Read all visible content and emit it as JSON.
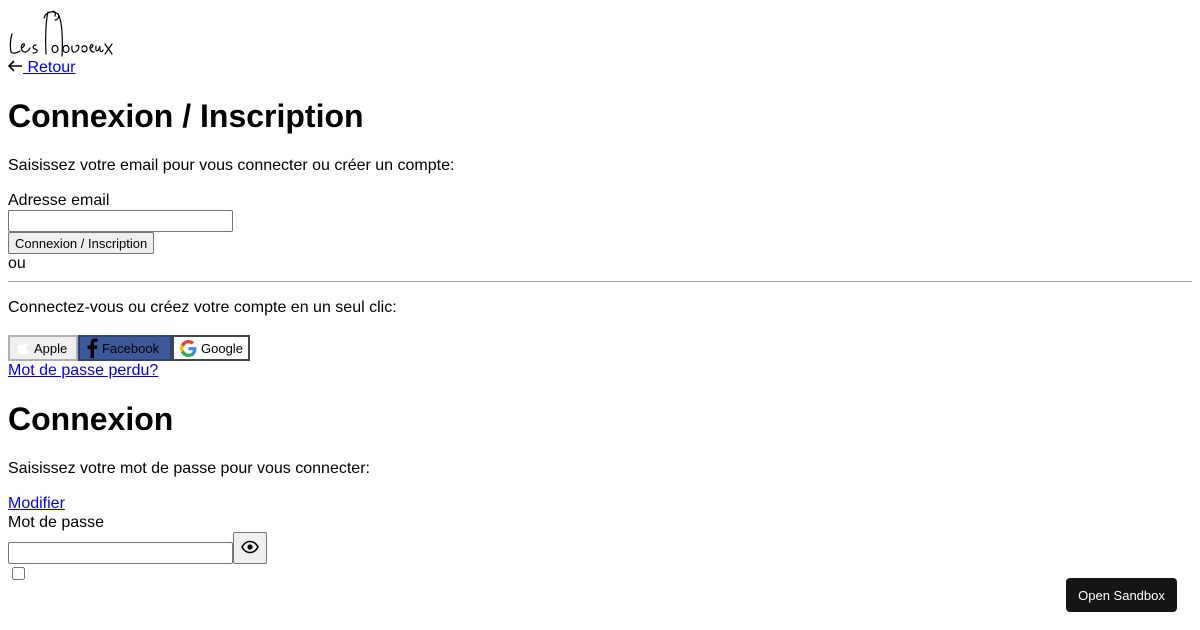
{
  "brand": {
    "logo_text": "Les Toboreux"
  },
  "nav": {
    "back_label": " Retour"
  },
  "login_signup": {
    "title": "Connexion / Inscription",
    "instruction": "Saisissez votre email pour vous connecter ou créer un compte:",
    "email_label": "Adresse email",
    "email_value": "",
    "submit_label": "Connexion / Inscription",
    "or_text": "ou",
    "social_instruction": "Connectez-vous ou créez votre compte en un seul clic:",
    "social_buttons": [
      {
        "label": "Apple",
        "icon": "apple-icon"
      },
      {
        "label": "Facebook",
        "icon": "facebook-icon"
      },
      {
        "label": "Google",
        "icon": "google-icon"
      }
    ],
    "forgot_password": "Mot de passe perdu?"
  },
  "login": {
    "title": "Connexion",
    "instruction": "Saisissez votre mot de passe pour vous connecter:",
    "modify_link": "Modifier",
    "password_label": "Mot de passe",
    "password_value": "",
    "toggle_icon": "eye-icon",
    "remember_checked": false
  },
  "sandbox": {
    "label": "Open Sandbox"
  },
  "colors": {
    "link": "#0000ee",
    "facebook": "#3b5998",
    "sandbox_bg": "#151515"
  }
}
